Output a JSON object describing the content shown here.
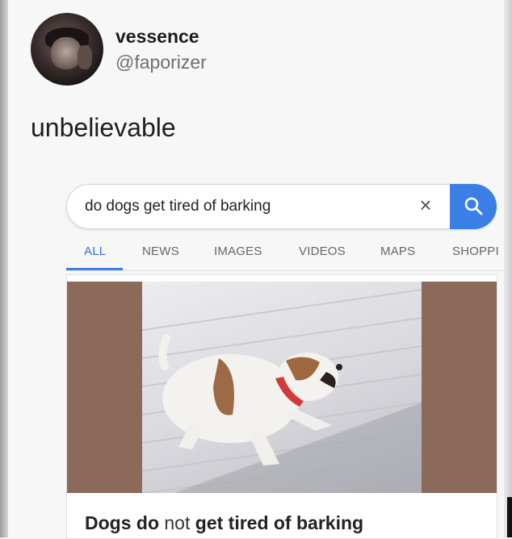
{
  "tweet": {
    "display_name": "vessence",
    "handle": "@faporizer",
    "text": "unbelievable"
  },
  "search": {
    "query": "do dogs get tired of barking",
    "clear_symbol": "×"
  },
  "tabs": [
    {
      "label": "ALL",
      "active": true
    },
    {
      "label": "NEWS",
      "active": false
    },
    {
      "label": "IMAGES",
      "active": false
    },
    {
      "label": "VIDEOS",
      "active": false
    },
    {
      "label": "MAPS",
      "active": false
    },
    {
      "label": "SHOPPI",
      "active": false
    }
  ],
  "result": {
    "title_part1": "Dogs do",
    "title_part2": "not",
    "title_part3": "get tired of barking"
  },
  "colors": {
    "accent": "#3b7fe6",
    "image_side_panels": "#8b6a59"
  }
}
